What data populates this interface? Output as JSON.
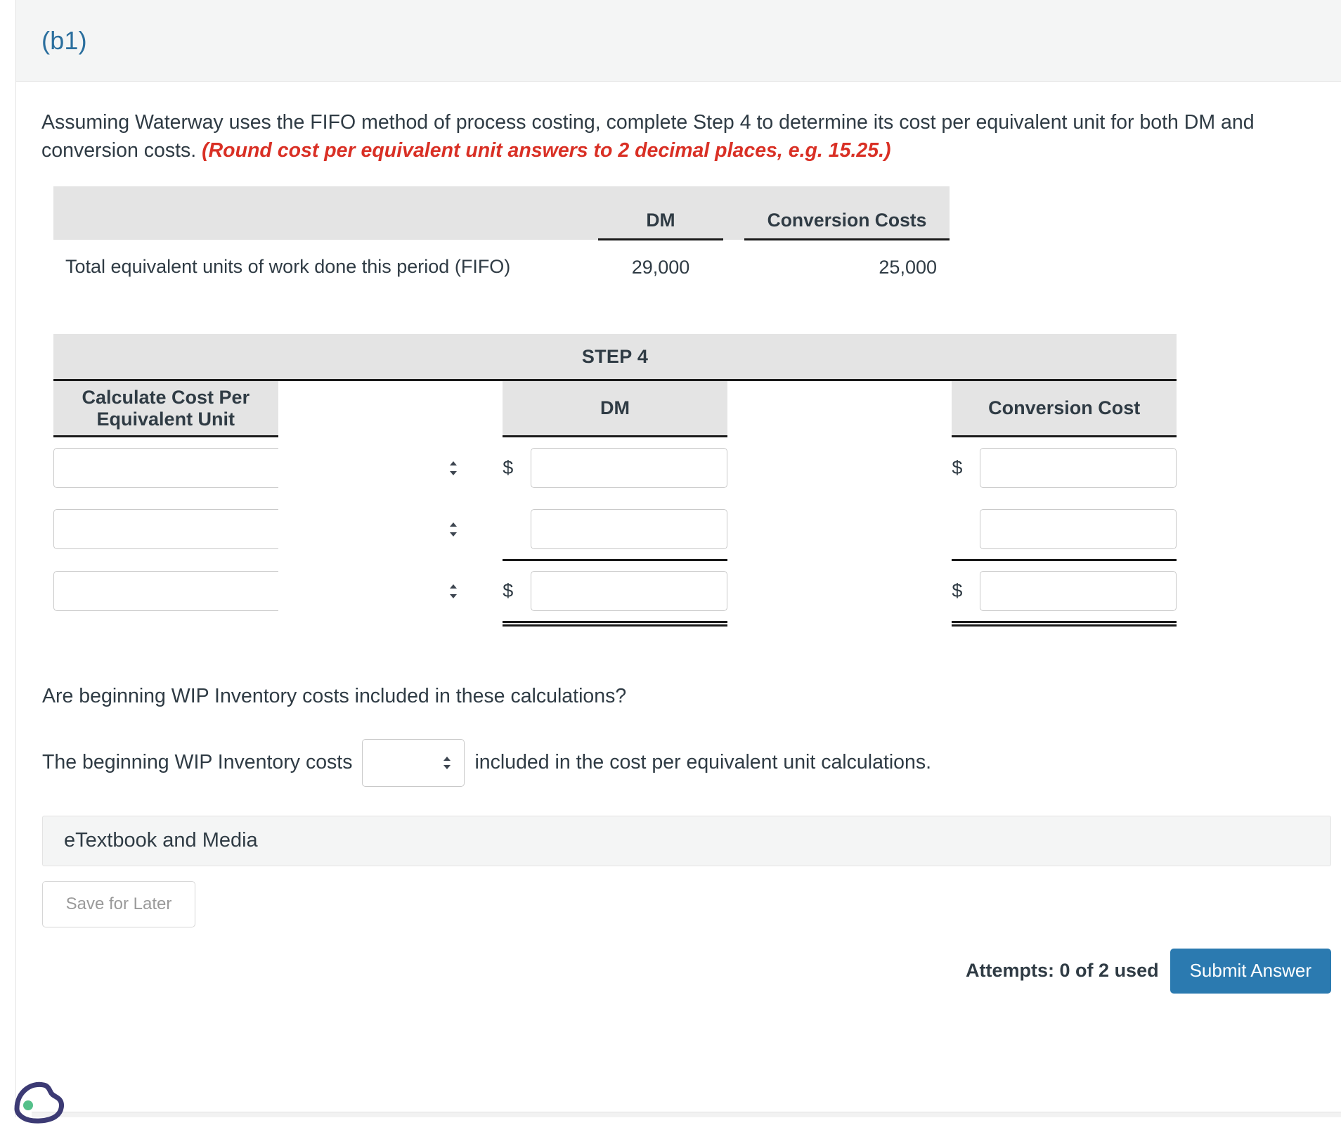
{
  "question": {
    "label": "(b1)",
    "prompt_part1": "Assuming Waterway uses the FIFO method of process costing, complete Step 4 to determine its cost per equivalent unit for both DM and conversion costs. ",
    "prompt_note": "(Round cost per equivalent unit answers to 2 decimal places, e.g. 15.25.)"
  },
  "equivalent_units_table": {
    "headers": {
      "blank": "",
      "dm": "DM",
      "conversion_costs": "Conversion Costs"
    },
    "rows": [
      {
        "label": "Total equivalent units of work done this period (FIFO)",
        "dm": "29,000",
        "conversion_costs": "25,000"
      }
    ]
  },
  "step4_table": {
    "title": "STEP 4",
    "headers": {
      "calc": "Calculate Cost Per Equivalent Unit",
      "dm": "DM",
      "conversion_cost": "Conversion Cost"
    },
    "rows": [
      {
        "select_value": "",
        "dm_prefix": "$",
        "dm_value": "",
        "cc_prefix": "$",
        "cc_value": ""
      },
      {
        "select_value": "",
        "dm_prefix": "",
        "dm_value": "",
        "cc_prefix": "",
        "cc_value": ""
      },
      {
        "select_value": "",
        "dm_prefix": "$",
        "dm_value": "",
        "cc_prefix": "$",
        "cc_value": ""
      }
    ]
  },
  "wip_question": {
    "question": "Are beginning WIP Inventory costs included in these calculations?",
    "sentence_before": "The beginning WIP Inventory costs",
    "select_value": "",
    "sentence_after": "included in the cost per equivalent unit calculations."
  },
  "etextbook": {
    "label": "eTextbook and Media"
  },
  "footer": {
    "save_for_later": "Save for Later",
    "attempts": "Attempts: 0 of 2 used",
    "submit": "Submit Answer"
  },
  "colors": {
    "header_label": "#2b6f9e",
    "note_red": "#d93025",
    "submit_blue": "#2b7ab0",
    "table_header_gray": "#e4e4e4",
    "panel_gray": "#f4f5f5"
  }
}
